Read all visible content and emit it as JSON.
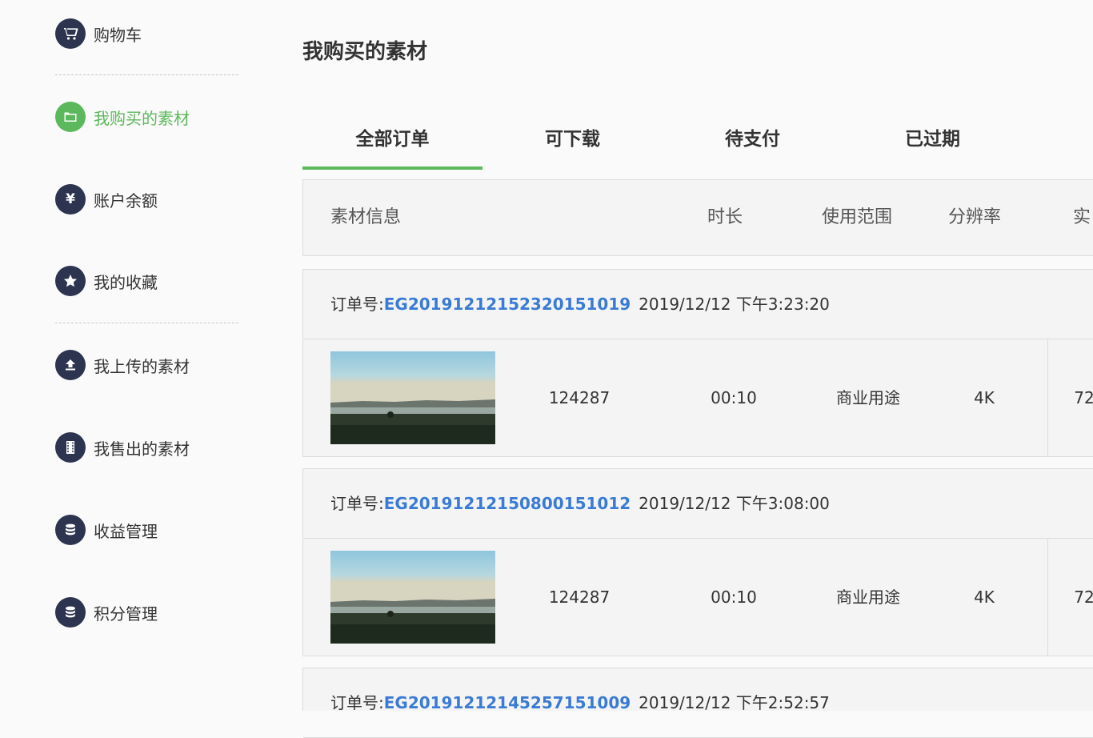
{
  "sidebar": {
    "items": [
      {
        "label": "购物车",
        "icon": "cart-icon"
      },
      {
        "label": "我购买的素材",
        "icon": "folder-icon",
        "active": true
      },
      {
        "label": "账户余额",
        "icon": "yen-icon",
        "glyph": "¥"
      },
      {
        "label": "我的收藏",
        "icon": "star-icon"
      },
      {
        "label": "我上传的素材",
        "icon": "upload-icon"
      },
      {
        "label": "我售出的素材",
        "icon": "film-icon"
      },
      {
        "label": "收益管理",
        "icon": "database-icon"
      },
      {
        "label": "积分管理",
        "icon": "database-icon"
      }
    ]
  },
  "main": {
    "title": "我购买的素材",
    "tabs": [
      {
        "label": "全部订单",
        "active": true
      },
      {
        "label": "可下载"
      },
      {
        "label": "待支付"
      },
      {
        "label": "已过期"
      }
    ],
    "columns": [
      "素材信息",
      "时长",
      "使用范围",
      "分辨率",
      "实"
    ],
    "order_prefix": "订单号:",
    "orders": [
      {
        "order_no": "EG20191212152320151019",
        "date": "2019/12/12 下午3:23:20",
        "id": "124287",
        "duration": "00:10",
        "usage": "商业用途",
        "resolution": "4K",
        "price": "72"
      },
      {
        "order_no": "EG20191212150800151012",
        "date": "2019/12/12 下午3:08:00",
        "id": "124287",
        "duration": "00:10",
        "usage": "商业用途",
        "resolution": "4K",
        "price": "72"
      },
      {
        "order_no": "EG20191212145257151009",
        "date": "2019/12/12 下午2:52:57"
      }
    ]
  },
  "colors": {
    "accent": "#5cb85c",
    "link": "#3a7bd5",
    "icon_bg": "#2d3450"
  }
}
